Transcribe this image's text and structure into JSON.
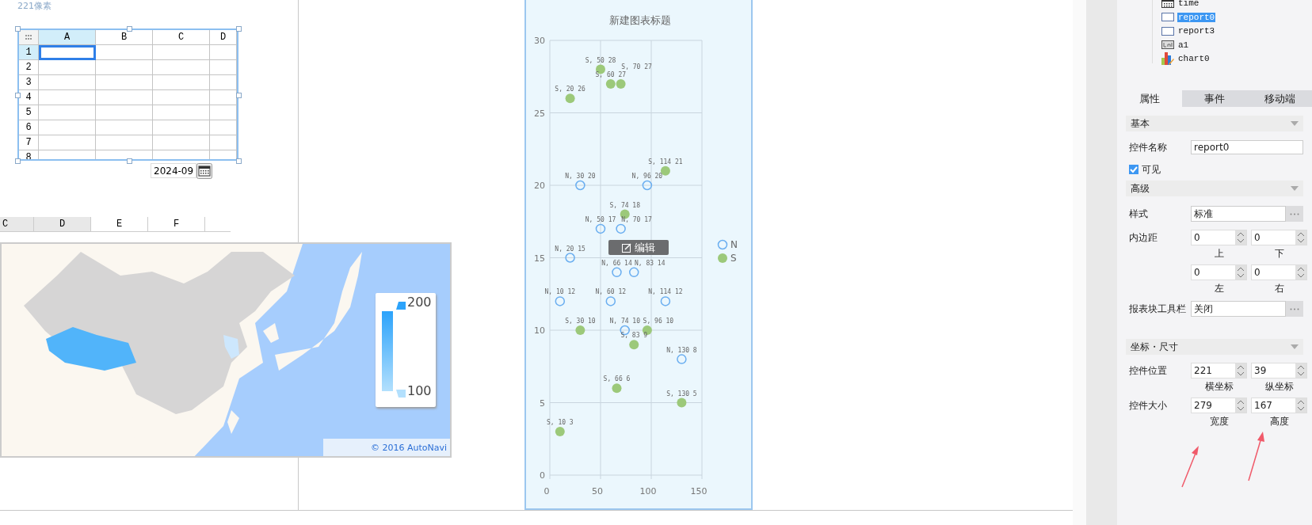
{
  "canvas": {
    "size_hint": "221像素",
    "grid_widget": {
      "columns": [
        {
          "label": "A",
          "selected": true
        },
        {
          "label": "B",
          "selected": false
        },
        {
          "label": "C",
          "selected": false
        },
        {
          "label": "D",
          "selected": false
        }
      ],
      "rows": [
        {
          "label": "1",
          "selected": true
        },
        {
          "label": "2",
          "selected": false
        },
        {
          "label": "3",
          "selected": false
        },
        {
          "label": "4",
          "selected": false
        },
        {
          "label": "5",
          "selected": false
        },
        {
          "label": "6",
          "selected": false
        },
        {
          "label": "7",
          "selected": false
        },
        {
          "label": "8",
          "selected": false
        }
      ]
    },
    "date_field": {
      "value": "2024-09"
    },
    "lower_grid": {
      "columns": [
        {
          "label": "C",
          "selected": true
        },
        {
          "label": "D",
          "selected": true
        },
        {
          "label": "E",
          "selected": false
        },
        {
          "label": "F",
          "selected": false
        }
      ]
    },
    "map": {
      "kind": "picture",
      "legend": {
        "max": "200",
        "min": "100"
      },
      "attribution": "© 2016 AutoNavi"
    },
    "chart": {
      "edit_button": "编辑",
      "chart_data": {
        "type": "scatter",
        "title": "新建图表标题",
        "xlim": [
          0,
          150
        ],
        "ylim": [
          0,
          30
        ],
        "xticks": [
          {
            "value": 0,
            "label": "0"
          },
          {
            "value": 50,
            "label": "50"
          },
          {
            "value": 100,
            "label": "100"
          },
          {
            "value": 150,
            "label": "150"
          }
        ],
        "yticks": [
          {
            "value": 0,
            "label": "0"
          },
          {
            "value": 5,
            "label": "5"
          },
          {
            "value": 10,
            "label": "10"
          },
          {
            "value": 15,
            "label": "15"
          },
          {
            "value": 20,
            "label": "20"
          },
          {
            "value": 25,
            "label": "25"
          },
          {
            "value": 30,
            "label": "30"
          }
        ],
        "data_labels": true,
        "grid": true,
        "legend": true,
        "series": [
          {
            "name": "N",
            "color": "#6aaef0",
            "x": [
              30,
              96,
              50,
              70,
              20,
              66,
              83,
              10,
              60,
              114,
              74,
              130
            ],
            "values": [
              20,
              20,
              17,
              17,
              15,
              14,
              14,
              12,
              12,
              12,
              10,
              8
            ],
            "value_labels": [
              "N, 30  20",
              "N, 96  20",
              "N, 50  17",
              "N, 70  17",
              "N, 20  15",
              "N, 66  14",
              "N, 83  14",
              "N, 10  12",
              "N, 60  12",
              "N, 114  12",
              "N, 74  10",
              "N, 130  8"
            ]
          },
          {
            "name": "S",
            "color": "#9cc97a",
            "x": [
              50,
              60,
              70,
              20,
              114,
              74,
              30,
              96,
              83,
              66,
              130,
              10
            ],
            "values": [
              28,
              27,
              27,
              26,
              21,
              18,
              10,
              10,
              9,
              6,
              5,
              3
            ],
            "value_labels": [
              "S, 50  28",
              "S, 60  27",
              "S, 70  27",
              "S, 20  26",
              "S, 114  21",
              "S, 74  18",
              "S, 30  10",
              "S, 96  10",
              "S, 83  9",
              "S, 66  6",
              "S, 130  5",
              "S, 10  3"
            ]
          }
        ]
      }
    }
  },
  "widget_tree": [
    {
      "label": "time",
      "kind": "date",
      "selected": false
    },
    {
      "label": "report0",
      "kind": "report",
      "selected": true
    },
    {
      "label": "report3",
      "kind": "report",
      "selected": false
    },
    {
      "label": "a1",
      "kind": "label",
      "selected": false
    },
    {
      "label": "chart0",
      "kind": "chart",
      "selected": false
    }
  ],
  "tabs": [
    {
      "label": "属性",
      "selected": true
    },
    {
      "label": "事件",
      "selected": false
    },
    {
      "label": "移动端",
      "selected": false
    }
  ],
  "sections": [
    {
      "title": "基本",
      "rows": [
        {
          "kind": "text",
          "label": "控件名称",
          "value": "report0"
        },
        {
          "kind": "checkbox",
          "label": "可见",
          "checked": true
        }
      ]
    },
    {
      "title": "高级",
      "rows": [
        {
          "kind": "picker",
          "label": "样式",
          "value": "标准"
        },
        {
          "kind": "pair",
          "label": "内边距",
          "fields": [
            {
              "value": "0",
              "caption": "上"
            },
            {
              "value": "0",
              "caption": "下"
            }
          ]
        },
        {
          "kind": "pair",
          "fields": [
            {
              "value": "0",
              "caption": "左"
            },
            {
              "value": "0",
              "caption": "右"
            }
          ]
        },
        {
          "kind": "picker",
          "label": "报表块工具栏",
          "value": "关闭"
        }
      ]
    },
    {
      "title": "坐标・尺寸",
      "rows": [
        {
          "kind": "pair",
          "label": "控件位置",
          "fields": [
            {
              "value": "221",
              "caption": "横坐标"
            },
            {
              "value": "39",
              "caption": "纵坐标"
            }
          ]
        },
        {
          "kind": "pair",
          "label": "控件大小",
          "fields": [
            {
              "value": "279",
              "caption": "宽度"
            },
            {
              "value": "167",
              "caption": "高度"
            }
          ]
        }
      ]
    }
  ]
}
